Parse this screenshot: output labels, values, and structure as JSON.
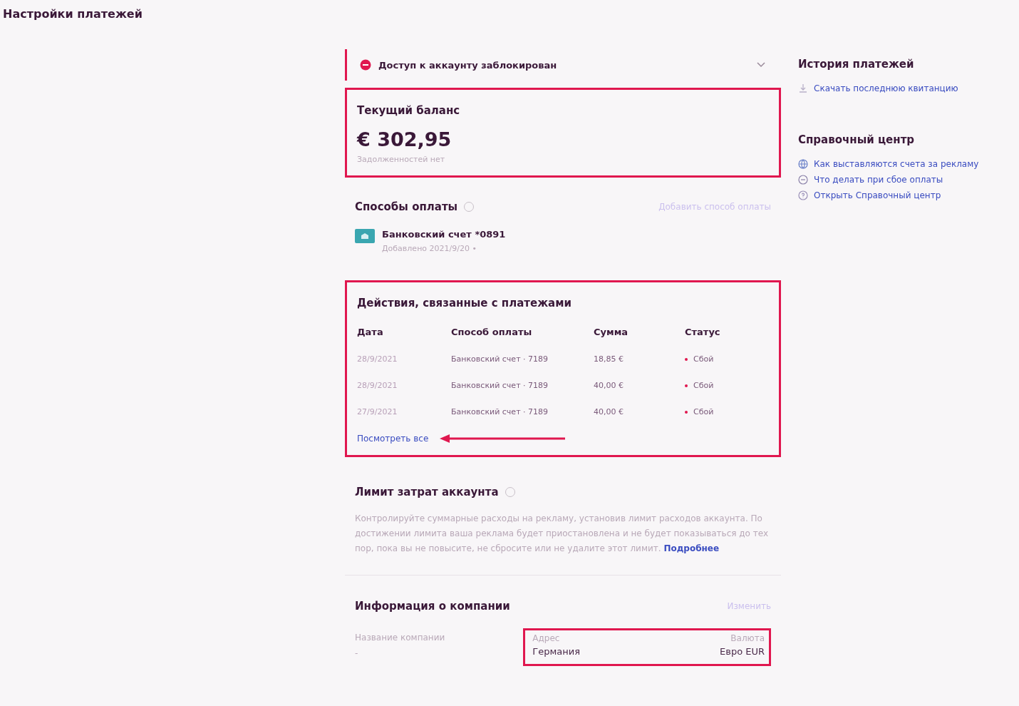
{
  "page": {
    "title": "Настройки платежей"
  },
  "alert": {
    "text": "Доступ к аккаунту заблокирован",
    "expanded": false
  },
  "balance": {
    "title": "Текущий баланс",
    "amount": "€ 302,95",
    "note": "Задолженностей нет",
    "highlighted": true
  },
  "payment_methods": {
    "title": "Способы оплаты",
    "add_button": "Добавить способ оплаты",
    "methods": [
      {
        "name": "Банковский счет *0891",
        "added": "Добавлено 2021/9/20 •"
      }
    ]
  },
  "activity": {
    "title": "Действия, связанные с платежами",
    "highlighted": true,
    "columns": [
      "Дата",
      "Способ оплаты",
      "Сумма",
      "Статус"
    ],
    "rows": [
      {
        "date": "28/9/2021",
        "method": "Банковский счет · 7189",
        "amount": "18,85 €",
        "status": "Сбой"
      },
      {
        "date": "28/9/2021",
        "method": "Банковский счет · 7189",
        "amount": "40,00 €",
        "status": "Сбой"
      },
      {
        "date": "27/9/2021",
        "method": "Банковский счет · 7189",
        "amount": "40,00 €",
        "status": "Сбой"
      }
    ],
    "view_all": "Посмотреть все"
  },
  "spending_limit": {
    "title": "Лимит затрат аккаунта",
    "text": "Контролируйте суммарные расходы на рекламу, установив лимит расходов аккаунта. По достижении лимита ваша реклама будет приостановлена и не будет показываться до тех пор, пока вы не повысите, не сбросите или не удалите этот лимит.",
    "link": "Подробнее"
  },
  "company": {
    "title": "Информация о компании",
    "edit_button": "Изменить",
    "name_field": {
      "label": "Название компании",
      "value": "-"
    },
    "details": {
      "highlighted": true,
      "fields": [
        {
          "label": "Адрес",
          "value": "Германия"
        },
        {
          "label": "Валюта",
          "value": "Евро EUR"
        }
      ]
    }
  },
  "sidebar": {
    "sections": [
      {
        "title": "История платежей",
        "links": [
          {
            "text": "Скачать последнюю квитанцию",
            "kind": "download"
          }
        ]
      },
      {
        "title": "Справочный центр",
        "links": [
          {
            "text": "Как выставляются счета за рекламу",
            "kind": "globe"
          },
          {
            "text": "Что делать при сбое оплаты",
            "kind": "minus"
          },
          {
            "text": "Открыть Справочный центр",
            "kind": "question"
          }
        ]
      }
    ]
  }
}
